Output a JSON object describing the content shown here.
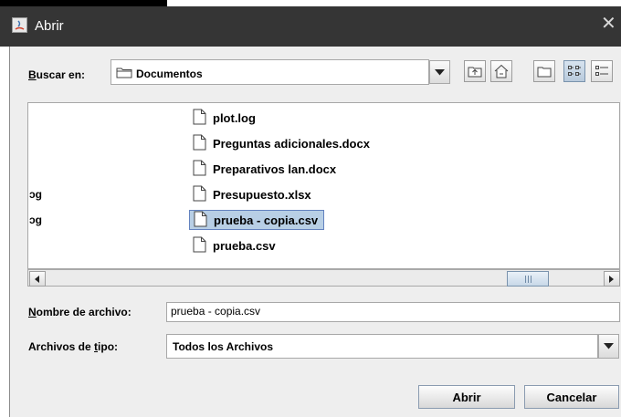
{
  "window": {
    "title": "Abrir",
    "close_glyph": "✕"
  },
  "look_in": {
    "label_prefix": "B",
    "label_rest": "uscar en:",
    "value": "Documentos"
  },
  "toolbar": {
    "icons": [
      "up-one-level-icon",
      "home-icon",
      "new-folder-icon",
      "list-view-icon",
      "details-view-icon"
    ]
  },
  "files": [
    {
      "name": "plot.log",
      "left_fragment": "",
      "selected": false
    },
    {
      "name": "Preguntas adicionales.docx",
      "left_fragment": "",
      "selected": false
    },
    {
      "name": "Preparativos lan.docx",
      "left_fragment": "",
      "selected": false
    },
    {
      "name": "Presupuesto.xlsx",
      "left_fragment": "ɔg",
      "selected": false
    },
    {
      "name": "prueba - copia.csv",
      "left_fragment": "ɔg",
      "selected": true
    },
    {
      "name": "prueba.csv",
      "left_fragment": "",
      "selected": false
    }
  ],
  "filename": {
    "label_prefix": "N",
    "label_rest": "ombre de archivo:",
    "value": "prueba - copia.csv"
  },
  "filetype": {
    "label_pre": "Archivos de ",
    "label_u": "t",
    "label_post": "ipo:",
    "value": "Todos los Archivos"
  },
  "buttons": {
    "open": "Abrir",
    "cancel": "Cancelar"
  },
  "colors": {
    "titlebar": "#353535",
    "selection": "#b8cfe5",
    "dialog_bg": "#eeeeee"
  }
}
